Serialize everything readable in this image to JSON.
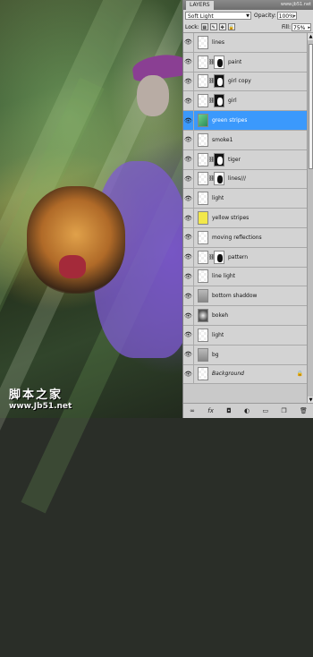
{
  "panel": {
    "tab_label": "LAYERS",
    "top_watermark": "www.jb51.net",
    "blend_mode": "Soft Light",
    "opacity_label": "Opacity:",
    "opacity_value": "100%",
    "lock_label": "Lock:",
    "fill_label": "Fill:",
    "fill_value": "75%"
  },
  "layers": [
    {
      "name": "lines",
      "thumb": "checker",
      "visible": true
    },
    {
      "name": "paint",
      "thumb": "checker",
      "mask": "white",
      "visible": true
    },
    {
      "name": "girl copy",
      "thumb": "checker",
      "mask": "black-figure",
      "visible": true
    },
    {
      "name": "girl",
      "thumb": "checker",
      "mask": "black-figure",
      "visible": true
    },
    {
      "name": "green stripes",
      "thumb": "green",
      "visible": true,
      "selected": true
    },
    {
      "name": "smoke1",
      "thumb": "checker",
      "visible": true
    },
    {
      "name": "tiger",
      "thumb": "checker",
      "mask": "black-figure",
      "visible": true
    },
    {
      "name": "lines///",
      "thumb": "checker",
      "mask": "white",
      "visible": true
    },
    {
      "name": "light",
      "thumb": "checker",
      "visible": true
    },
    {
      "name": "yellow stripes",
      "thumb": "yellow",
      "visible": true
    },
    {
      "name": "moving reflections",
      "thumb": "checker",
      "visible": true
    },
    {
      "name": "pattern",
      "thumb": "checker",
      "mask": "white",
      "visible": true
    },
    {
      "name": "line light",
      "thumb": "checker",
      "visible": true
    },
    {
      "name": "bottom shaddow",
      "thumb": "gray",
      "visible": true
    },
    {
      "name": "bokeh",
      "thumb": "dark",
      "visible": true
    },
    {
      "name": "light",
      "thumb": "checker",
      "visible": true
    },
    {
      "name": "bg",
      "thumb": "gray",
      "visible": true
    },
    {
      "name": "Background",
      "thumb": "checker",
      "visible": true,
      "locked": true,
      "italic": true
    }
  ],
  "footer_icons": [
    "link-icon",
    "fx-icon",
    "mask-icon",
    "adjustment-icon",
    "folder-icon",
    "new-layer-icon",
    "trash-icon"
  ],
  "watermark": {
    "chinese": "脚本之家",
    "url": "www.Jb51.net"
  }
}
